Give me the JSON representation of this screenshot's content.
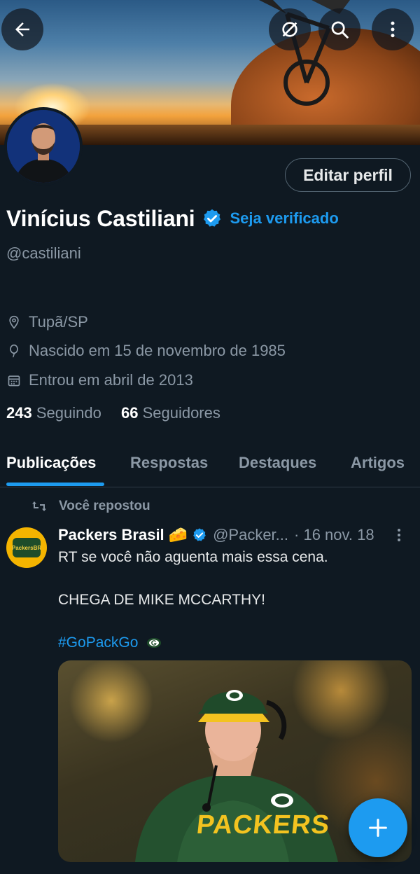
{
  "profile": {
    "name": "Vinícius Castiliani",
    "verify_link": "Seja verificado",
    "handle": "@castiliani",
    "location": "Tupã/SP",
    "birth": "Nascido em 15 de novembro de 1985",
    "joined": "Entrou em abril de 2013",
    "following_count": "243",
    "following_label": "Seguindo",
    "followers_count": "66",
    "followers_label": "Seguidores",
    "edit_button": "Editar perfil"
  },
  "tabs": [
    {
      "label": "Publicações"
    },
    {
      "label": "Respostas"
    },
    {
      "label": "Destaques"
    },
    {
      "label": "Artigos"
    }
  ],
  "post": {
    "repost_label": "Você repostou",
    "author": "Packers Brasil",
    "author_emoji": "🧀",
    "handle": "@Packer...",
    "date": "· 16 nov. 18",
    "line1": "RT se você não aguenta mais essa cena.",
    "line2": "CHEGA DE MIKE MCCARTHY!",
    "hashtag": "#GoPackGo",
    "avatar_text": "PackersBR",
    "media_text": "PACKERS"
  },
  "colors": {
    "accent": "#1d9bf0",
    "background": "#0f1922",
    "muted": "#8b98a5"
  },
  "icons": [
    "back-arrow-icon",
    "no-bike-icon",
    "search-icon",
    "more-vertical-icon",
    "verified-badge-icon",
    "location-pin-icon",
    "birthday-balloon-icon",
    "calendar-icon",
    "repost-icon",
    "compose-plus-icon"
  ]
}
